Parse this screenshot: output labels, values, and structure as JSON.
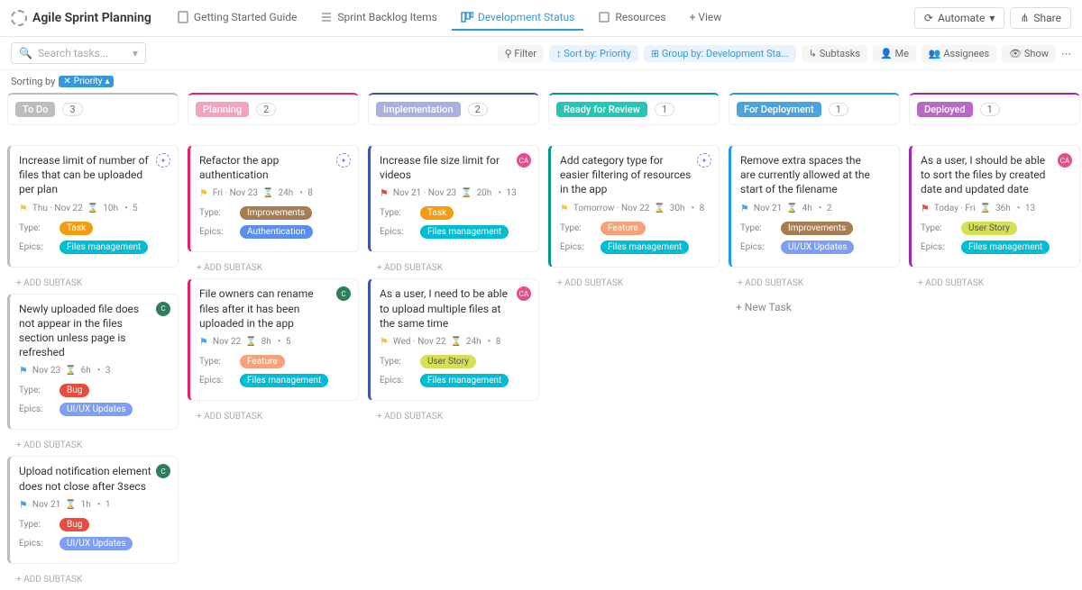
{
  "header": {
    "title": "Agile Sprint Planning",
    "tabs": [
      {
        "label": "Getting Started Guide"
      },
      {
        "label": "Sprint Backlog Items"
      },
      {
        "label": "Development Status",
        "active": true
      },
      {
        "label": "Resources"
      }
    ],
    "addView": "+ View",
    "automate": "Automate",
    "share": "Share"
  },
  "toolbar": {
    "searchPh": "Search tasks...",
    "filter": "Filter",
    "sort": "Sort by: Priority",
    "group": "Group by: Development Sta...",
    "subtasks": "Subtasks",
    "me": "Me",
    "assignees": "Assignees",
    "show": "Show"
  },
  "sortRow": {
    "label": "Sorting by",
    "pill": "Priority"
  },
  "columns": [
    {
      "name": "To Do",
      "color": "#bdbdbd",
      "pill": "#bdbdbd",
      "count": "3",
      "cards": [
        {
          "title": "Increase limit of number of files that can be uploaded per plan",
          "flag": "#f5c242",
          "date": "Thu · Nov 22",
          "est": "10h",
          "pts": "5",
          "type": "task",
          "typeLabel": "Task",
          "epic": "fm",
          "epicLabel": "Files management",
          "avatar": "sparkle"
        },
        {
          "title": "Newly uploaded file does not appear in the files section unless page is refreshed",
          "flag": "#4aa3df",
          "date": "Nov 23",
          "est": "6h",
          "pts": "3",
          "type": "bug",
          "typeLabel": "Bug",
          "epic": "ui",
          "epicLabel": "UI/UX Updates",
          "avatar": "#2e7d5b",
          "avTxt": "C"
        },
        {
          "title": "Upload notification element does not close after 3secs",
          "flag": "#4aa3df",
          "date": "Nov 21",
          "est": "1h",
          "pts": "1",
          "type": "bug",
          "typeLabel": "Bug",
          "epic": "ui",
          "epicLabel": "UI/UX Updates",
          "avatar": "#2e7d5b",
          "avTxt": "C"
        }
      ]
    },
    {
      "name": "Planning",
      "color": "#e91e63",
      "pill": "#f5a3bd",
      "count": "2",
      "cards": [
        {
          "title": "Refactor the app authentication",
          "flag": "#f5c242",
          "date": "Fri · Nov 23",
          "est": "24h",
          "pts": "8",
          "type": "imp",
          "typeLabel": "Improvements",
          "epic": "auth",
          "epicLabel": "Authentication",
          "avatar": "sparkle"
        },
        {
          "title": "File owners can rename files after it has been uploaded in the app",
          "flag": "#4aa3df",
          "date": "Nov 22",
          "est": "8h",
          "pts": "5",
          "type": "feat",
          "typeLabel": "Feature",
          "epic": "fm",
          "epicLabel": "Files management",
          "avatar": "#2e7d5b",
          "avTxt": "C"
        }
      ]
    },
    {
      "name": "Implementation",
      "color": "#3f51b5",
      "pill": "#a7b0e0",
      "count": "2",
      "cards": [
        {
          "title": "Increase file size limit for videos",
          "flag": "#e74c3c",
          "date": "Nov 21 · Nov 23",
          "est": "20h",
          "pts": "13",
          "type": "task",
          "typeLabel": "Task",
          "epic": "fm",
          "epicLabel": "Files management",
          "avatar": "#e74c8c",
          "avTxt": "CA"
        },
        {
          "title": "As a user, I need to be able to upload multiple files at the same time",
          "flag": "#f5c242",
          "date": "Wed · Nov 22",
          "est": "24h",
          "pts": "8",
          "type": "us",
          "typeLabel": "User Story",
          "epic": "fm",
          "epicLabel": "Files management",
          "avatar": "#e74c8c",
          "avTxt": "CA"
        }
      ]
    },
    {
      "name": "Ready for Review",
      "color": "#009688",
      "pill": "#26c6b4",
      "count": "1",
      "cards": [
        {
          "title": "Add category type for easier filtering of resources in the app",
          "flag": "#f5c242",
          "date": "Tomorrow · Nov 22",
          "est": "30h",
          "pts": "8",
          "type": "feat",
          "typeLabel": "Feature",
          "epic": "fm",
          "epicLabel": "Files management",
          "avatar": "sparkle"
        }
      ]
    },
    {
      "name": "For Deployment",
      "color": "#2196f3",
      "pill": "#4aa3df",
      "count": "1",
      "newTask": true,
      "cards": [
        {
          "title": "Remove extra spaces the are currently allowed at the start of the filename",
          "flag": "#4aa3df",
          "date": "Nov 21",
          "est": "4h",
          "pts": "2",
          "type": "imp",
          "typeLabel": "Improvements",
          "epic": "ui",
          "epicLabel": "UI/UX Updates"
        }
      ]
    },
    {
      "name": "Deployed",
      "color": "#9c27b0",
      "pill": "#ba68c8",
      "count": "1",
      "cards": [
        {
          "title": "As a user, I should be able to sort the files by created date and updated date",
          "flag": "#e74c3c",
          "date": "Today · Fri",
          "est": "36h",
          "pts": "13",
          "type": "us",
          "typeLabel": "User Story",
          "epic": "fm",
          "epicLabel": "Files management",
          "avatar": "#e74c8c",
          "avTxt": "CA"
        }
      ]
    }
  ],
  "labels": {
    "type": "Type:",
    "epics": "Epics:",
    "addSub": "+ ADD SUBTASK",
    "newTask": "+ New Task"
  }
}
